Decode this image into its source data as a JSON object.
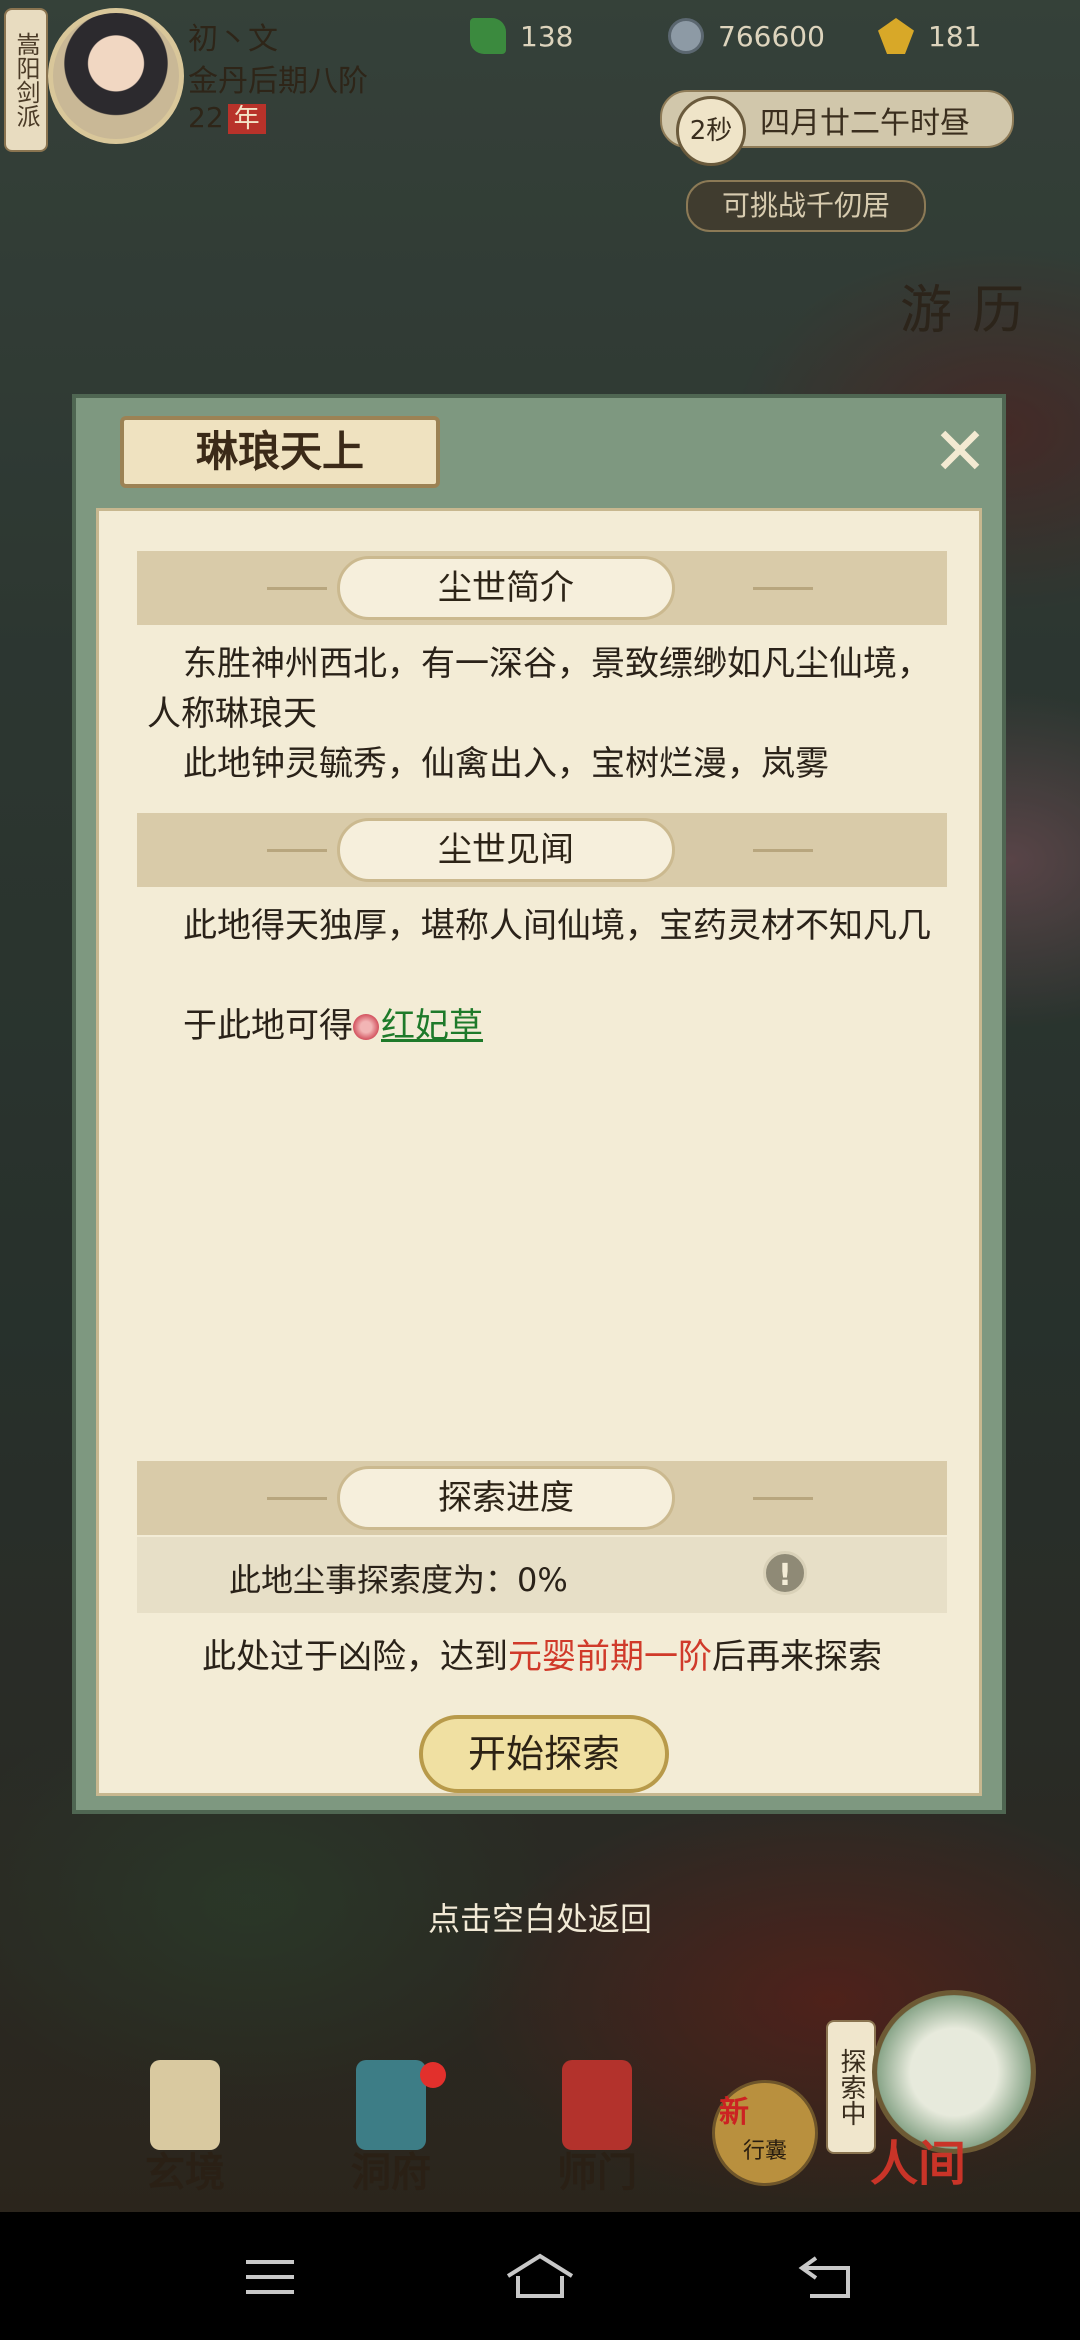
{
  "status": {
    "sect": "嵩阳剑派",
    "player_name": "初丶文",
    "realm": "金丹后期八阶",
    "age": "22",
    "age_unit": "年",
    "jade": "138",
    "coins": "766600",
    "gold": "181",
    "time_seconds": "2秒",
    "game_date": "四月廿二午时昼",
    "challenge": "可挑战千仞居",
    "youli": "游历"
  },
  "dialog": {
    "title": "琳琅天上",
    "close_symbol": "✕",
    "intro_header": "尘世简介",
    "intro_text_1": "东胜神州西北，有一深谷，景致缥缈如凡尘仙境，人称琳琅天",
    "intro_text_2": "此地钟灵毓秀，仙禽出入，宝树烂漫，岚雾",
    "news_header": "尘世见闻",
    "news_text": "此地得天独厚，堪称人间仙境，宝药灵材不知凡几",
    "obtain_prefix": "于此地可得",
    "obtain_item": "红妃草",
    "progress_header": "探索进度",
    "progress_text": "此地尘事探索度为：0%",
    "warn_symbol": "!",
    "danger_prefix": "此处过于凶险，达到",
    "danger_realm": "元婴前期一阶",
    "danger_suffix": "后再来探索",
    "start_button": "开始探索"
  },
  "return_hint": "点击空白处返回",
  "bottom_nav": {
    "xuanjing": "玄境",
    "dongfu": "洞府",
    "shimen": "师门",
    "xinglang_new": "新",
    "xinglang": "行囊",
    "tansuo_status": "探索中",
    "renjian": "人间"
  },
  "colors": {
    "accent_red": "#d03a2a",
    "link_green": "#1e7a2a",
    "dialog_frame": "#7e9880"
  }
}
